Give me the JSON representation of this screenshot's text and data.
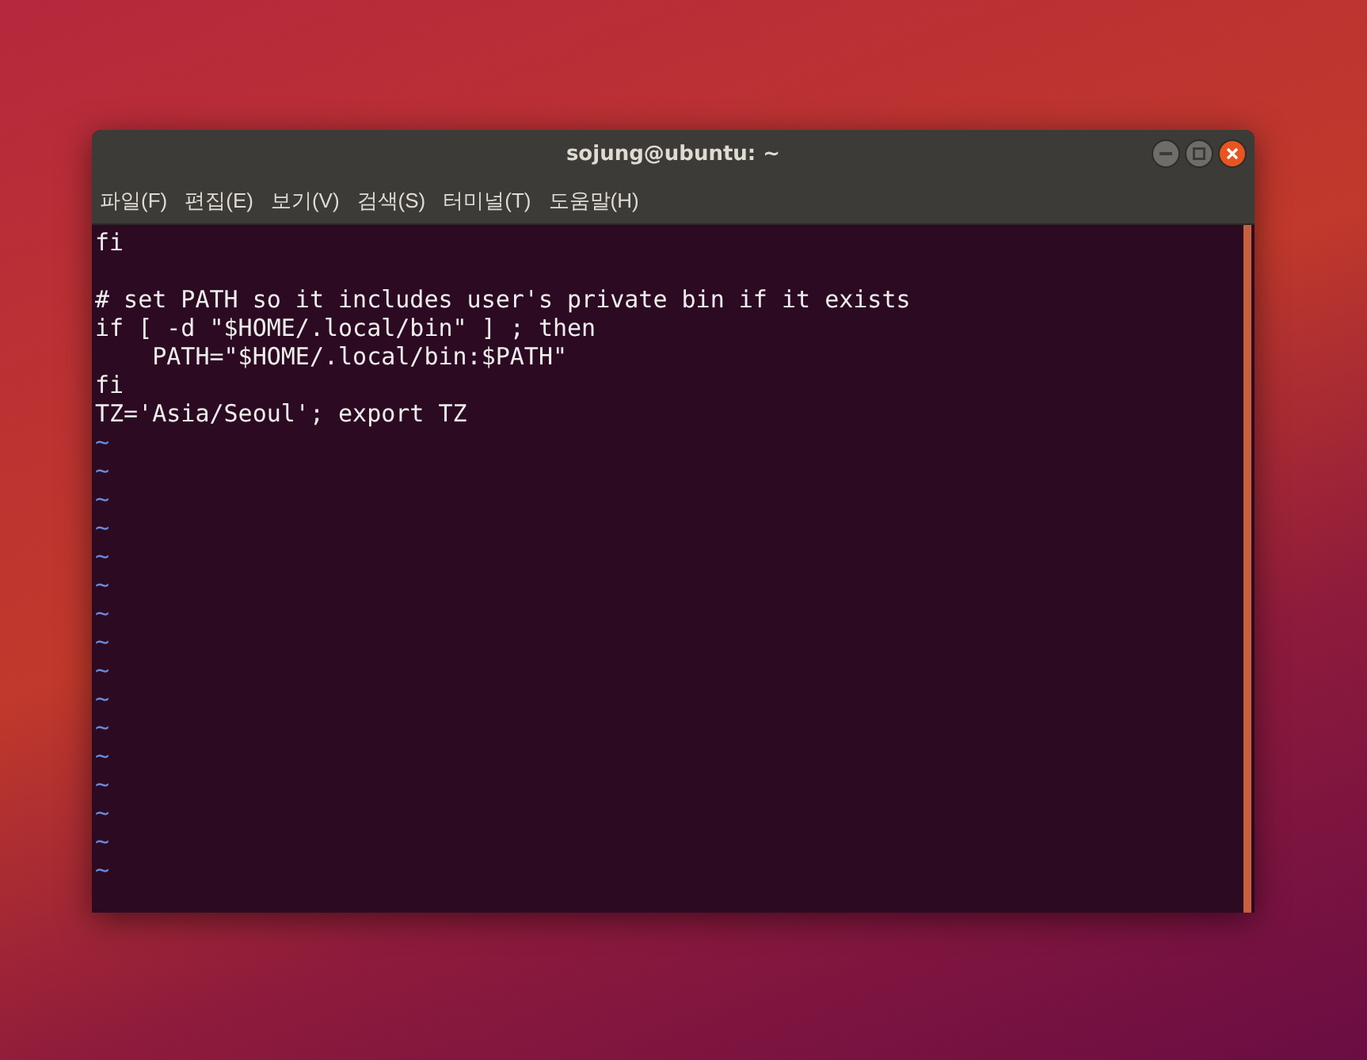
{
  "window": {
    "title": "sojung@ubuntu: ~"
  },
  "menu": [
    "파일(F)",
    "편집(E)",
    "보기(V)",
    "검색(S)",
    "터미널(T)",
    "도움말(H)"
  ],
  "lines": [
    {
      "kind": "text",
      "text": "fi"
    },
    {
      "kind": "blank"
    },
    {
      "kind": "text",
      "text": "# set PATH so it includes user's private bin if it exists"
    },
    {
      "kind": "text",
      "text": "if [ -d \"$HOME/.local/bin\" ] ; then"
    },
    {
      "kind": "text",
      "text": "    PATH=\"$HOME/.local/bin:$PATH\""
    },
    {
      "kind": "text",
      "text": "fi"
    },
    {
      "kind": "text",
      "text": "TZ='Asia/Seoul'; export TZ"
    },
    {
      "kind": "tilde",
      "text": "~"
    },
    {
      "kind": "tilde",
      "text": "~"
    },
    {
      "kind": "tilde",
      "text": "~"
    },
    {
      "kind": "tilde",
      "text": "~"
    },
    {
      "kind": "tilde",
      "text": "~"
    },
    {
      "kind": "tilde",
      "text": "~"
    },
    {
      "kind": "tilde",
      "text": "~"
    },
    {
      "kind": "tilde",
      "text": "~"
    },
    {
      "kind": "tilde",
      "text": "~"
    },
    {
      "kind": "tilde",
      "text": "~"
    },
    {
      "kind": "tilde",
      "text": "~"
    },
    {
      "kind": "tilde",
      "text": "~"
    },
    {
      "kind": "tilde",
      "text": "~"
    },
    {
      "kind": "tilde",
      "text": "~"
    },
    {
      "kind": "tilde",
      "text": "~"
    },
    {
      "kind": "tilde",
      "text": "~"
    }
  ]
}
